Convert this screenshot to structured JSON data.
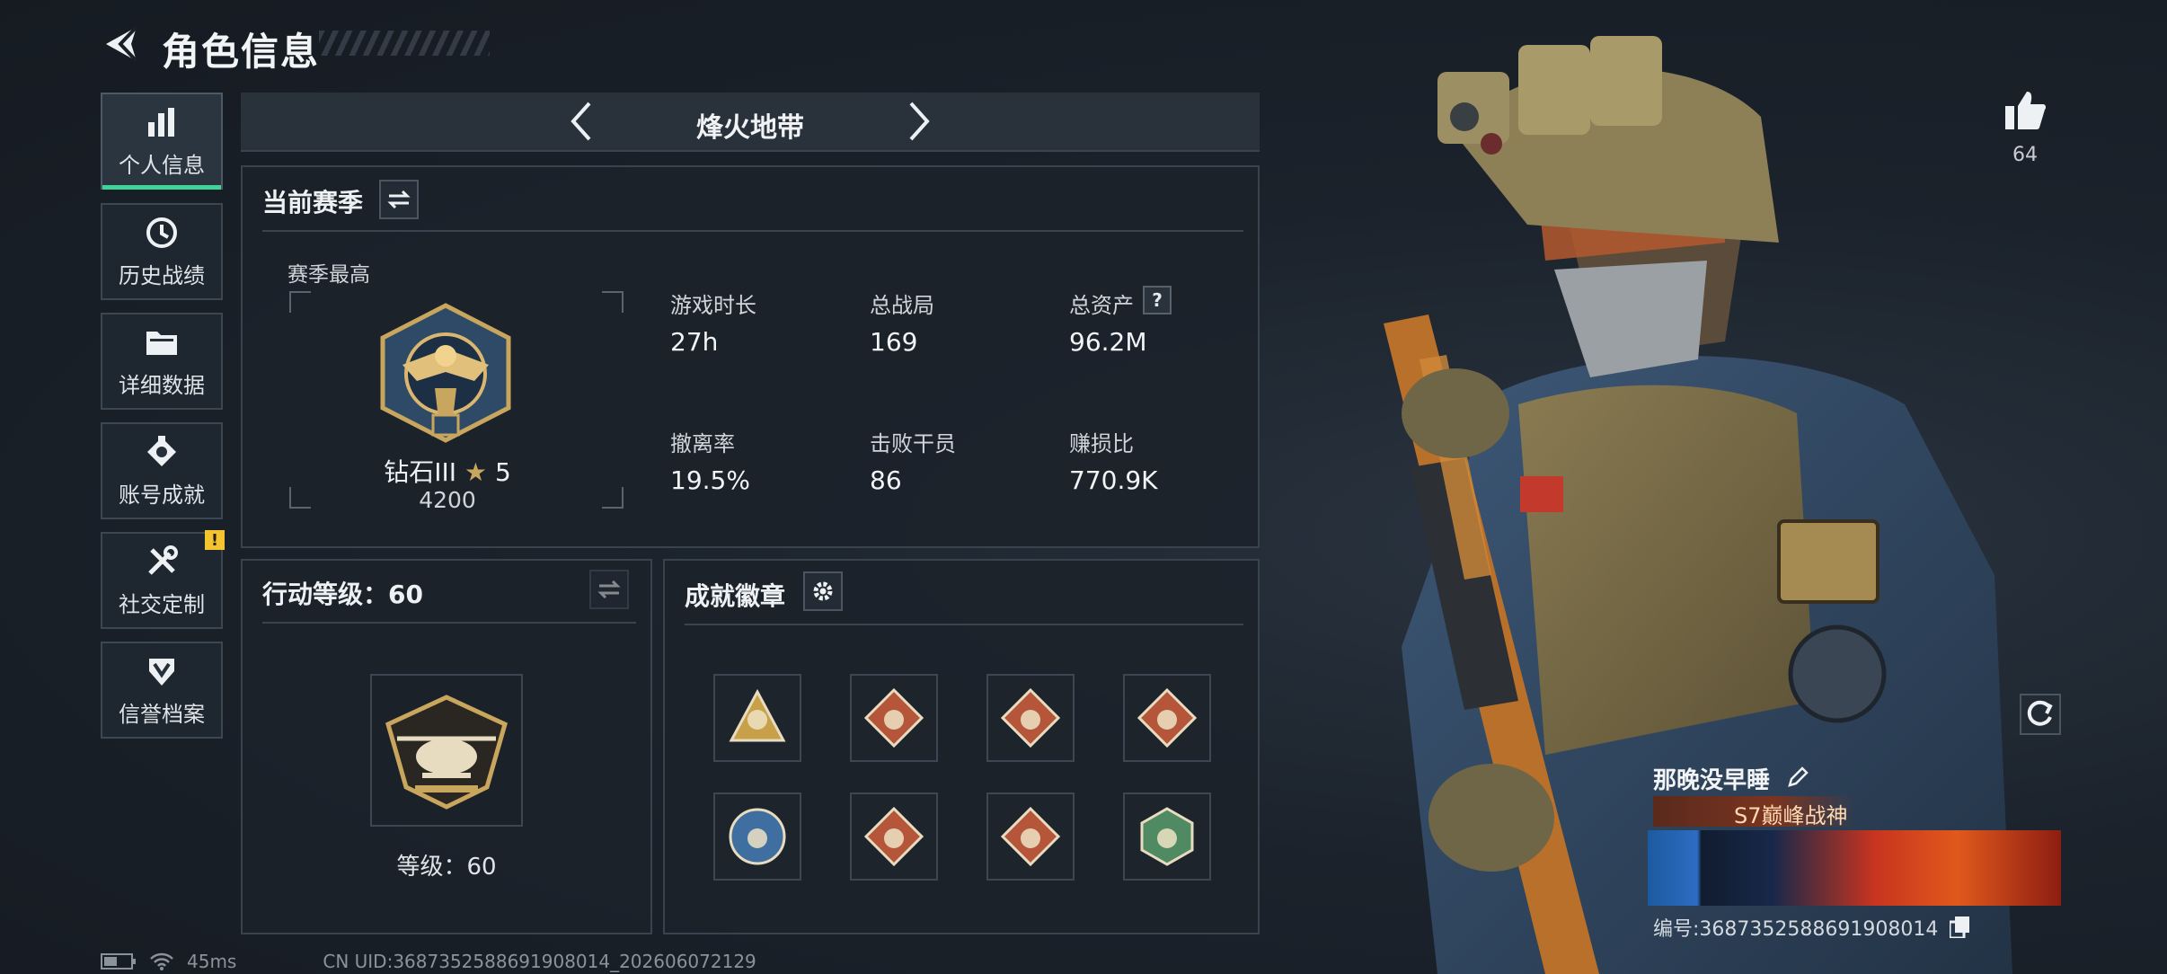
{
  "header": {
    "title": "角色信息"
  },
  "nav": {
    "items": [
      {
        "label": "个人信息",
        "icon": "bar-chart-icon",
        "active": true
      },
      {
        "label": "历史战绩",
        "icon": "history-icon"
      },
      {
        "label": "详细数据",
        "icon": "folder-icon"
      },
      {
        "label": "账号成就",
        "icon": "achievement-icon"
      },
      {
        "label": "社交定制",
        "icon": "tools-icon",
        "alert": "!"
      },
      {
        "label": "信誉档案",
        "icon": "credit-shield-icon"
      }
    ]
  },
  "mode": {
    "title": "烽火地带"
  },
  "season": {
    "title": "当前赛季",
    "best_label": "赛季最高",
    "rank_name": "钻石III",
    "rank_stars": "5",
    "rank_points": "4200",
    "stats": [
      {
        "label": "游戏时长",
        "value": "27h"
      },
      {
        "label": "总战局",
        "value": "169"
      },
      {
        "label": "总资产",
        "value": "96.2M",
        "help": "?"
      },
      {
        "label": "撤离率",
        "value": "19.5%"
      },
      {
        "label": "击败干员",
        "value": "86"
      },
      {
        "label": "赚损比",
        "value": "770.9K"
      }
    ]
  },
  "action_level": {
    "title": "行动等级：60",
    "level_text": "等级：60"
  },
  "badges": {
    "title": "成就徽章",
    "items": [
      {
        "icon": "pyramid-badge-icon",
        "color": "#c9a04a"
      },
      {
        "icon": "dragon-badge-icon",
        "color": "#b5563a"
      },
      {
        "icon": "runner-badge-icon",
        "color": "#b5563a"
      },
      {
        "icon": "fist-badge-icon",
        "color": "#b5563a"
      },
      {
        "icon": "eagle-badge-icon",
        "color": "#3e6fa0"
      },
      {
        "icon": "beast-badge-icon",
        "color": "#b5563a"
      },
      {
        "icon": "wolf-badge-icon",
        "color": "#b5563a"
      },
      {
        "icon": "bird-badge-icon",
        "color": "#4f8a62"
      }
    ]
  },
  "profile": {
    "likes": "64",
    "name": "那晚没早睡",
    "title_badge": "S7巅峰战神",
    "uid_label": "编号:3687352588691908014"
  },
  "status": {
    "ping": "45ms",
    "uid": "CN UID:3687352588691908014_202606072129"
  },
  "colors": {
    "accent": "#3fd39a",
    "alert": "#f4c430",
    "panel_border": "#39434e"
  }
}
